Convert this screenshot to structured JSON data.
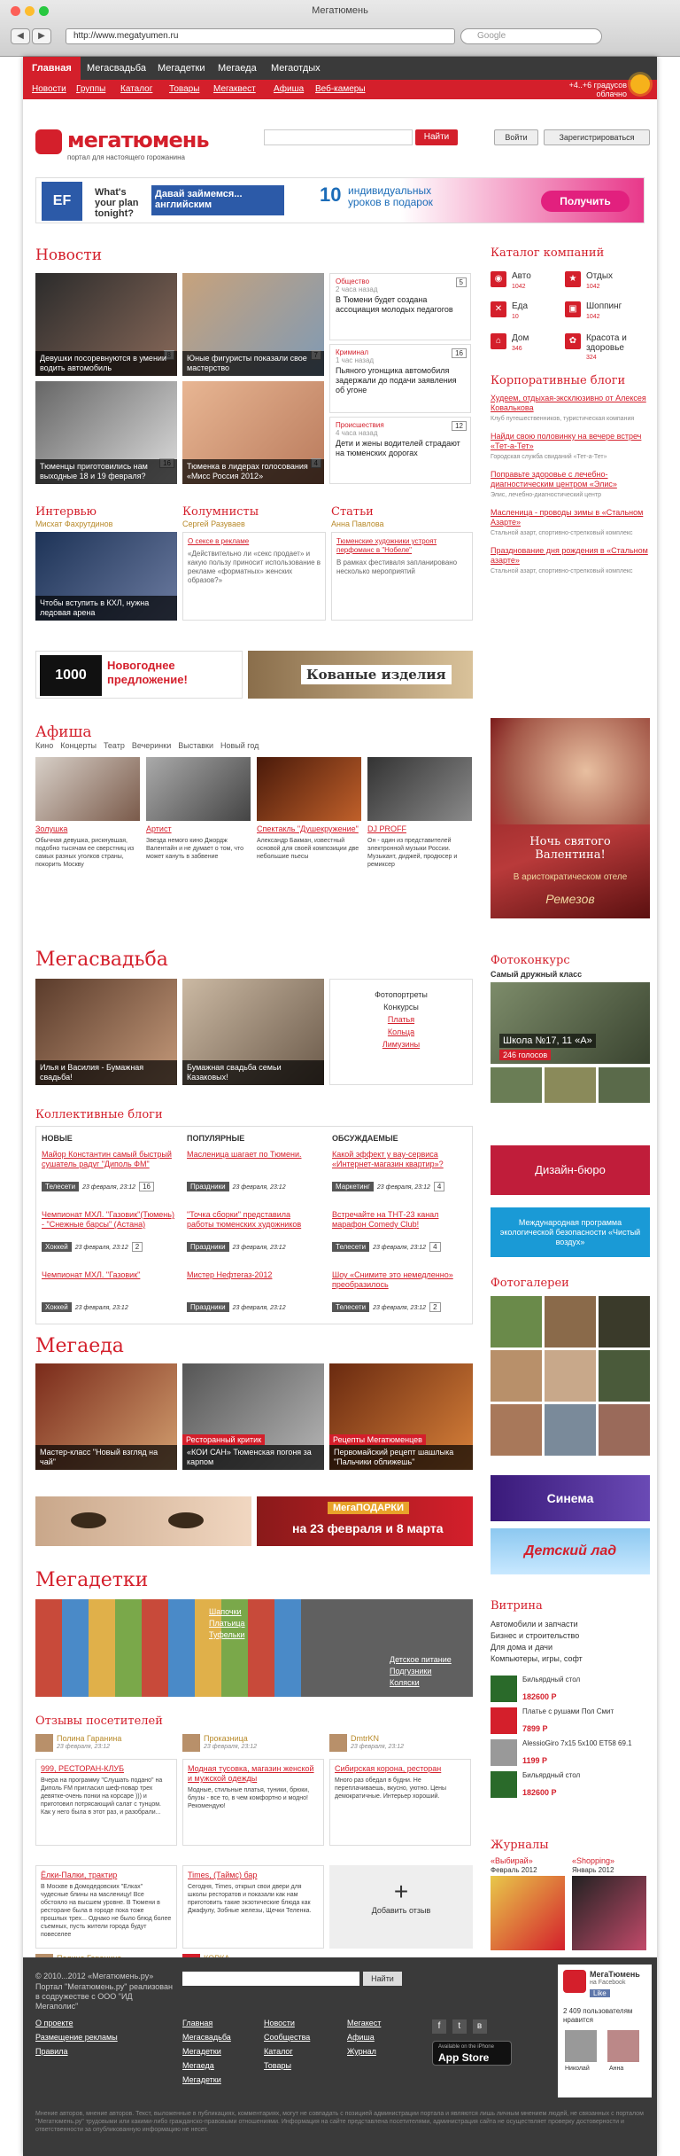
{
  "browser": {
    "title": "Мегатюмень",
    "url": "http://www.megatyumen.ru",
    "search_placeholder": "Google"
  },
  "topnav": [
    "Главная",
    "Мегасвадьба",
    "Мегадетки",
    "Мегаеда",
    "Мегаотдых"
  ],
  "subnav": [
    "Новости",
    "Группы",
    "Каталог",
    "Товары",
    "Мегаквест",
    "Афиша",
    "Веб-камеры"
  ],
  "weather": {
    "temp": "+4..+6 градусов",
    "cond": "облачно"
  },
  "header": {
    "logo": "мегатюмень",
    "slogan": "портал для настоящего горожанина",
    "search_btn": "Найти",
    "login": "Войти",
    "register": "Зарегистрироваться"
  },
  "banner": {
    "brand": "EF",
    "q": "What's your plan tonight?",
    "a": "Давай займемся... английским",
    "big": "10",
    "offer": "индивидуальных уроков в подарок",
    "cta": "Получить"
  },
  "news": {
    "title": "Новости",
    "photos": [
      {
        "caption": "Девушки посоревнуются в умении водить автомобиль",
        "count": "8"
      },
      {
        "caption": "Юные фигуристы показали свое мастерство",
        "count": "7"
      },
      {
        "caption": "Тюменцы приготовились нам выходные 18 и 19 февраля?",
        "count": "16"
      },
      {
        "caption": "Тюменка в лидерах голосования «Мисс Россия 2012»",
        "count": "4"
      }
    ],
    "items": [
      {
        "cat": "Общество",
        "time": "2 часа назад",
        "text": "В Тюмени будет создана ассоциация молодых педагогов",
        "n": "5"
      },
      {
        "cat": "Криминал",
        "time": "1 час назад",
        "text": "Пьяного угонщика автомобиля задержали до подачи заявления об угоне",
        "n": "16"
      },
      {
        "cat": "Происшествия",
        "time": "4 часа назад",
        "text": "Дети и жены водителей страдают на тюменских дорогах",
        "n": "12"
      }
    ]
  },
  "catalog": {
    "title": "Каталог компаний",
    "items": [
      {
        "name": "Авто",
        "n": "1042"
      },
      {
        "name": "Отдых",
        "n": "1042"
      },
      {
        "name": "Еда",
        "n": "10"
      },
      {
        "name": "Шоппинг",
        "n": "1042"
      },
      {
        "name": "Дом",
        "n": "346"
      },
      {
        "name": "Красота и здоровье",
        "n": "324"
      }
    ]
  },
  "corp": {
    "title": "Корпоративные блоги",
    "items": [
      {
        "t": "Худеем, отдыхая-эксклюзивно от Алексея Ковалькова",
        "s": "Клуб путешественников, туристическая компания"
      },
      {
        "t": "Найди свою половинку на вечере встреч «Тет-а-Тет»",
        "s": "Городская служба свиданий «Тет-а-Тет»"
      },
      {
        "t": "Поправьте здоровье с лечебно-диагностическим центром «Элис»",
        "s": "Элис, лечебно-диагностический центр"
      },
      {
        "t": "Масленица - проводы зимы в «Стальном Азарте»",
        "s": "Стальной азарт, спортивно-стрелковый комплекс"
      },
      {
        "t": "Празднование дня рождения в «Стальном азарте»",
        "s": "Стальной азарт, спортивно-стрелковый комплекс"
      }
    ]
  },
  "interview": {
    "title": "Интервью",
    "author": "Мисхат Фахрутдинов",
    "caption": "Чтобы вступить в КХЛ, нужна ледовая арена"
  },
  "columnists": {
    "title": "Колумнисты",
    "author": "Сергей Разуваев",
    "link": "О сексе в рекламе",
    "text": "«Действительно ли «секс продает» и какую пользу приносит использование в рекламе «форматных» женских образов?»"
  },
  "articles": {
    "title": "Статьи",
    "author": "Анна Павлова",
    "link": "Тюменские художники устроят перфоманс в \"Нобеле\"",
    "text": "В рамках фестиваля запланировано несколько мероприятий"
  },
  "ads": {
    "a1": "1000 watts",
    "a1t": "Новогоднее предложение!",
    "a2": "Кованые изделия"
  },
  "afisha": {
    "title": "Афиша",
    "tabs": [
      "Кино",
      "Концерты",
      "Театр",
      "Вечеринки",
      "Выставки",
      "Новый год"
    ],
    "items": [
      {
        "t": "Золушка",
        "d": "Обычная девушка, рискнувшая, подобно тысячам ее сверстниц из самых разных уголков страны, покорить Москву"
      },
      {
        "t": "Артист",
        "d": "Звезда немого кино Джордж Валентайн и не думает о том, что может кануть в забвение"
      },
      {
        "t": "Спектакль \"Душекружение\"",
        "d": "Александр Бакман, известный основой для своей композиции две небольшие пьесы"
      },
      {
        "t": "DJ PROFF",
        "d": "Он - один из представителей электронной музыки России. Музыкант, диджей, продюсер и ремиксер"
      }
    ]
  },
  "valentine": {
    "line1": "Ночь святого Валентина!",
    "line2": "В аристократическом отеле",
    "brand": "Ремезов"
  },
  "wedding": {
    "title": "Мегасвадьба",
    "c1": "Илья и Василия - Бумажная свадьба!",
    "c2": "Бумажная свадьба семьи Казаковых!",
    "links": [
      "Фотопортреты",
      "Конкурсы",
      "Платья",
      "Кольца",
      "Лимузины"
    ]
  },
  "contest": {
    "title": "Фотоконкурс",
    "sub": "Самый дружный класс",
    "school": "Школа №17, 11 «А»",
    "votes": "246 голосов"
  },
  "blogs": {
    "title": "Коллективные блоги",
    "cols": [
      {
        "h": "НОВЫЕ",
        "items": [
          {
            "t": "Майор Константин самый быстрый сушатель радуг \"Диполь ФМ\"",
            "tag": "Телесети",
            "date": "23 февраля, 23:12",
            "n": "16"
          },
          {
            "t": "Чемпионат МХЛ. \"Газовик\"(Тюмень) - \"Снежные барсы\" (Астана)",
            "tag": "Хоккей",
            "date": "23 февраля, 23:12",
            "n": "2"
          },
          {
            "t": "Чемпионат МХЛ. \"Газовик\"",
            "tag": "Хоккей",
            "date": "23 февраля, 23:12",
            "n": ""
          }
        ]
      },
      {
        "h": "ПОПУЛЯРНЫЕ",
        "items": [
          {
            "t": "Масленица шагает по Тюмени.",
            "tag": "Праздники",
            "date": "23 февраля, 23:12",
            "n": ""
          },
          {
            "t": "\"Точка сборки\" представила работы тюменских художников",
            "tag": "Праздники",
            "date": "23 февраля, 23:12",
            "n": ""
          },
          {
            "t": "Мистер Нефтегаз-2012",
            "tag": "Праздники",
            "date": "23 февраля, 23:12",
            "n": ""
          }
        ]
      },
      {
        "h": "ОБСУЖДАЕМЫЕ",
        "items": [
          {
            "t": "Какой эффект у вау-сервиса «Интернет-магазин квартир»?",
            "tag": "Маркетинг",
            "date": "23 февраля, 23:12",
            "n": "4"
          },
          {
            "t": "Встречайте на ТНТ-23 канал марафон Comedy Club!",
            "tag": "Телесети",
            "date": "23 февраля, 23:12",
            "n": "4"
          },
          {
            "t": "Шоу «Снимите это немедленно» преобразилось",
            "tag": "Телесети",
            "date": "23 февраля, 23:12",
            "n": "2"
          }
        ]
      }
    ]
  },
  "design": {
    "a": "Дизайн-бюро",
    "b": "Международная программа экологической безопасности «Чистый воздух»"
  },
  "galleries": {
    "title": "Фотогалереи"
  },
  "food": {
    "title": "Мегаеда",
    "c1": "Мастер-класс \"Новый взгляд на чай\"",
    "c2l": "Ресторанный критик",
    "c2": "«КОИ САН» Тюменская погоня за карпом",
    "c3l": "Рецепты Мегатюменцев",
    "c3": "Первомайский рецепт шашлыка \"Пальчики оближешь\""
  },
  "promo": {
    "title": "МегаПОДАРКИ",
    "sub": "на 23 февраля и 8 марта"
  },
  "cinema": {
    "name": "Синема"
  },
  "park": {
    "name": "Детский лад"
  },
  "kids": {
    "title": "Мегадетки",
    "links1": [
      "Шапочки",
      "Платьица",
      "Туфельки"
    ],
    "links2": [
      "Детское питание",
      "Подгузники",
      "Коляски"
    ]
  },
  "showcase": {
    "title": "Витрина",
    "cats": [
      "Автомобили и запчасти",
      "Бизнес и строительство",
      "Для дома и дачи",
      "Компьютеры, игры, софт"
    ],
    "items": [
      {
        "t": "Бильярдный стол",
        "p": "182600 Р"
      },
      {
        "t": "Платье с рушами Пол Смит",
        "p": "7899 Р"
      },
      {
        "t": "AlessioGiro 7x15 5x100 ET58 69.1",
        "p": "1199 Р"
      },
      {
        "t": "Бильярдный стол",
        "p": "182600 Р"
      }
    ]
  },
  "reviews": {
    "title": "Отзывы посетителей",
    "items": [
      {
        "user": "Полина Гаранина",
        "date": "23 февраля, 23:12",
        "t": "999, РЕСТОРАН-КЛУБ",
        "d": "Вчера на программу \"Слушать подано\" на Диполь FM пригласил шеф-повар трех девятке-очень понки на корсаре ))) и приготовил потрясающий салат с тунцом. Как у него была в этот раз, и разобрали..."
      },
      {
        "user": "Проказница",
        "date": "23 февраля, 23:12",
        "t": "Модная тусовка, магазин женской и мужской одежды",
        "d": "Модные, стильные платья, туники, брюки, блузы - все то, в чем комфортно и модно! Рекомендую!"
      },
      {
        "user": "DmtrKN",
        "date": "23 февраля, 23:12",
        "t": "Сибирская корона, ресторан",
        "d": "Много раз обедал в будни. Не переплачиваешь, вкусно, уютно. Цены демократичные. Интерьер хороший."
      },
      {
        "user": "",
        "date": "",
        "t": "Ёлки-Палки, трактир",
        "d": "В Москве в Домодедовских \"Елках\" чудесные блины на масленицу! Все обстояло на высшем уровне. В Тюмени в ресторане была в городе пока тоже прошлых трех... Однако не было блюд более съемных, пусть жители города будут повеселее"
      },
      {
        "user": "",
        "date": "",
        "t": "Times, (Таймс) бар",
        "d": "Сегодня, Times, открыл свои двери для школы ресторатов и показали как нам приготовить такие экзотические блюда как Джафулу, Зобные железы, Щечки Теленка."
      },
      {
        "user": "",
        "date": "",
        "t": "Добавить отзыв",
        "d": ""
      },
      {
        "user": "Полина Гаранина",
        "date": "23 февраля, 23:12",
        "t": "",
        "d": ""
      },
      {
        "user": "КОРКА",
        "date": "23 февраля, 23:12",
        "t": "",
        "d": ""
      }
    ]
  },
  "journals": {
    "title": "Журналы",
    "j1": "«Выбирай»",
    "j1d": "Февраль 2012",
    "j2": "«Shopping»",
    "j2d": "Январь 2012"
  },
  "footer": {
    "copy": "© 2010...2012 «Мегатюмень.ру»",
    "portal": "Портал \"Мегатюмень.ру\" реализован в содружестве с ООО \"ИД Мегаполис\"",
    "find": "Найти",
    "col1": [
      "О проекте",
      "Размещение рекламы",
      "Правила"
    ],
    "col2": [
      "Главная",
      "Мегасвадьба",
      "Мегадетки",
      "Мегаеда",
      "Мегадетки"
    ],
    "col3": [
      "Новости",
      "Сообщества",
      "Каталог",
      "Товары"
    ],
    "col4": [
      "Мегакест",
      "Афиша",
      "Журнал"
    ],
    "fb": "МегаТюмень",
    "fbsub": "на Facebook",
    "like": "Like",
    "fbcount": "2 409 пользователям нравится",
    "u1": "Николай",
    "u2": "Анна",
    "store": "App Store",
    "store_sub": "Available on the iPhone",
    "disclaimer": "Мнение авторов, мнение авторов. Текст, выложенные в публикациях, комментариях, могут не совпадать с позицией администрации портала и являются лишь личным мнением людей, не связанных с порталом \"Мегатюмень.ру\" трудовыми или какими-либо гражданско-правовыми отношениями. Информация на сайте представлена посетителями, администрация сайта не осуществляет проверку достоверности и ответственности за опубликованную информацию не несет."
  },
  "colors": {
    "brand": "#d41f2b",
    "dark": "#3a3a3a"
  }
}
